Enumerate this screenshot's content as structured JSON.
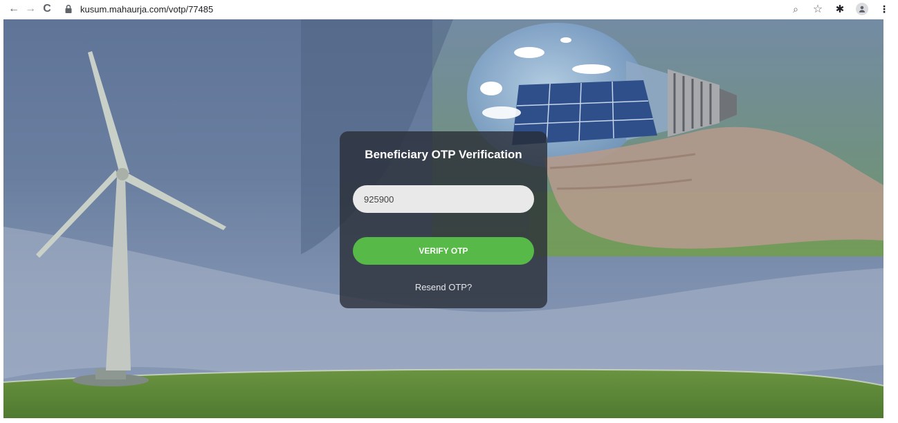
{
  "browser": {
    "url": "kusum.mahaurja.com/votp/77485",
    "back_glyph": "←",
    "forward_glyph": "→",
    "reload_glyph": "C",
    "zoom_glyph": "⌕",
    "star_glyph": "☆",
    "extensions_glyph": "✱",
    "menu_glyph": "⋮"
  },
  "otp_card": {
    "title": "Beneficiary OTP Verification",
    "otp_value": "925900",
    "verify_label": "VERIFY OTP",
    "resend_label": "Resend OTP?"
  },
  "colors": {
    "button_green": "#57b947",
    "card_bg": "#282c34",
    "sky_blue": "#5f7497",
    "grass_green": "#5e8a3a"
  },
  "icons": {
    "back": "arrow-left-icon",
    "forward": "arrow-right-icon",
    "reload": "reload-icon",
    "lock": "lock-icon",
    "zoom": "zoom-icon",
    "bookmark": "star-icon",
    "extensions": "puzzle-icon",
    "profile": "profile-icon",
    "menu": "kebab-menu-icon"
  }
}
